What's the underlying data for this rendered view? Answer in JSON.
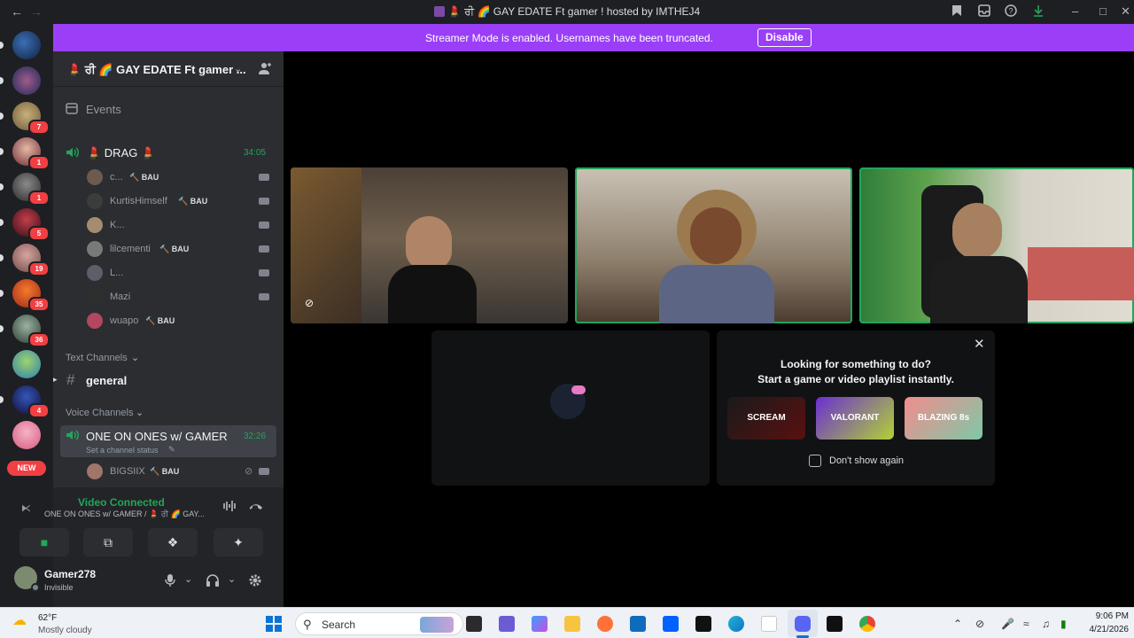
{
  "window": {
    "title": "💄 ਰੀ 🌈 GAY EDATE Ft gamer ! hosted by IMTHEJ4",
    "icons": [
      "back-arrow-icon",
      "forward-arrow-icon",
      "bookmark-icon",
      "inbox-icon",
      "help-icon",
      "download-icon",
      "minimize-icon",
      "maximize-icon",
      "close-icon"
    ]
  },
  "banner": {
    "message": "Streamer Mode is enabled. Usernames have been truncated.",
    "button": "Disable"
  },
  "rail": {
    "badges": [
      "7",
      "1",
      "1",
      "5",
      "19",
      "35",
      "36",
      "4"
    ],
    "new_label": "NEW"
  },
  "server": {
    "name": "💄 ਰੀ 🌈 GAY EDATE Ft gamer ...",
    "events_label": "Events"
  },
  "drag_channel": {
    "name": "💄 DRAG 💄",
    "timer": "34:05",
    "users": [
      {
        "name": "c...",
        "tag": "🔨 BAU",
        "cam": true
      },
      {
        "name": "KurtisHimself",
        "tag": "🔨 BAU",
        "cam": true
      },
      {
        "name": "K...",
        "tag": "",
        "cam": true
      },
      {
        "name": "lilcementi",
        "tag": "🔨 BAU",
        "cam": true
      },
      {
        "name": "L...",
        "tag": "",
        "cam": true
      },
      {
        "name": "Mazi",
        "tag": "",
        "cam": true
      },
      {
        "name": "wuapo",
        "tag": "🔨 BAU",
        "cam": false
      }
    ]
  },
  "text_channels": {
    "label": "Text Channels",
    "general": "general"
  },
  "voice_channels": {
    "label": "Voice Channels",
    "active": {
      "name": "ONE ON ONES w/ GAMER",
      "timer": "32:26",
      "status_placeholder": "Set a channel status"
    },
    "user": {
      "name": "BIGSIIX",
      "tag": "🔨 BAU"
    }
  },
  "voice_panel": {
    "status": "Video Connected",
    "channel": "ONE ON ONES w/ GAMER / 💄 ਰੀ 🌈 GAY...",
    "buttons": [
      "camera-icon",
      "screen-share-icon",
      "activities-icon",
      "soundboard-icon"
    ]
  },
  "user_panel": {
    "name": "Gamer278",
    "status": "Invisible"
  },
  "promo": {
    "line1": "Looking for something to do?",
    "line2": "Start a game or video playlist instantly.",
    "games": [
      "SCREAM",
      "VALORANT",
      "BLAZING 8s"
    ],
    "checkbox_label": "Don't show again"
  },
  "taskbar": {
    "weather_temp": "62°F",
    "weather_desc": "Mostly cloudy",
    "search_placeholder": "Search",
    "time": "9:06 PM",
    "date": "4/21/2026"
  }
}
